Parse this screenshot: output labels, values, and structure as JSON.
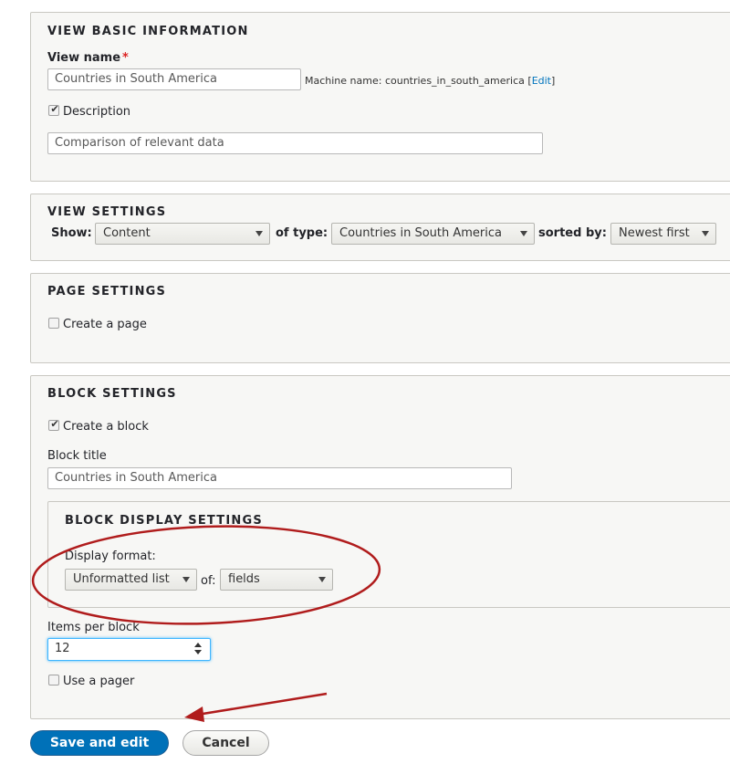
{
  "basic_info": {
    "legend": "View basic information",
    "view_name_label": "View name",
    "required_marker": "*",
    "view_name_value": "Countries in South America",
    "machine_name_prefix": "Machine name: countries_in_south_america",
    "machine_name_edit_open": "[",
    "machine_name_edit": "Edit",
    "machine_name_edit_close": "]",
    "description_checked": true,
    "description_label": "Description",
    "description_value": "Comparison of relevant data"
  },
  "view_settings": {
    "legend": "View settings",
    "show_label": "Show:",
    "show_value": "Content",
    "of_type_label": "of type:",
    "of_type_value": "Countries in South America",
    "sorted_by_label": "sorted by:",
    "sorted_by_value": "Newest first"
  },
  "page_settings": {
    "legend": "Page settings",
    "create_page_checked": false,
    "create_page_label": "Create a page"
  },
  "block_settings": {
    "legend": "Block settings",
    "create_block_checked": true,
    "create_block_label": "Create a block",
    "block_title_label": "Block title",
    "block_title_value": "Countries in South America",
    "display": {
      "legend": "Block display settings",
      "display_format_label": "Display format:",
      "display_format_value": "Unformatted list",
      "of_label": "of:",
      "of_value": "fields"
    },
    "items_per_block_label": "Items per block",
    "items_per_block_value": "12",
    "use_pager_checked": false,
    "use_pager_label": "Use a pager"
  },
  "actions": {
    "save_label": "Save and edit",
    "cancel_label": "Cancel"
  },
  "annotations": {
    "ellipse_color": "#b01c1c",
    "arrow_color": "#b01c1c"
  }
}
